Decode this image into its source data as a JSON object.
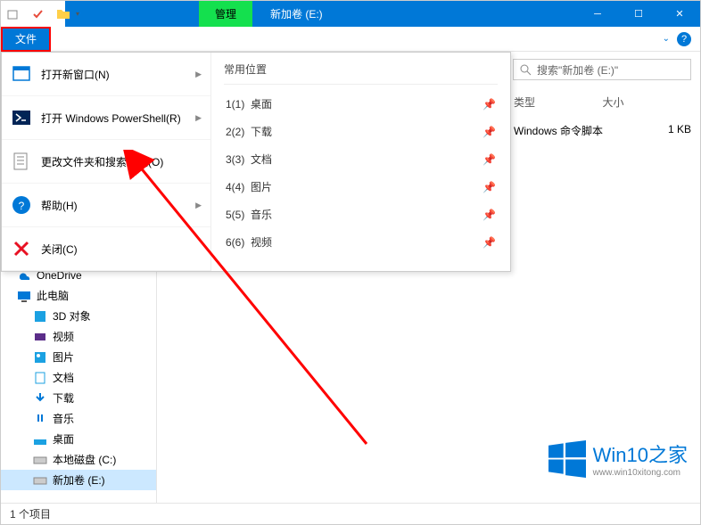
{
  "titlebar": {
    "manage": "管理",
    "title": "新加卷 (E:)"
  },
  "ribbon": {
    "file": "文件"
  },
  "search": {
    "placeholder": "搜索\"新加卷 (E:)\""
  },
  "columns": {
    "type": "类型",
    "size": "大小"
  },
  "file_row": {
    "name": "Windows 命令脚本",
    "size": "1 KB"
  },
  "filemenu": {
    "new_window": "打开新窗口(N)",
    "powershell": "打开 Windows PowerShell(R)",
    "options": "更改文件夹和搜索选项(O)",
    "help": "帮助(H)",
    "close": "关闭(C)",
    "locations_head": "常用位置",
    "loc": [
      {
        "k": "1(1)",
        "n": "桌面"
      },
      {
        "k": "2(2)",
        "n": "下载"
      },
      {
        "k": "3(3)",
        "n": "文档"
      },
      {
        "k": "4(4)",
        "n": "图片"
      },
      {
        "k": "5(5)",
        "n": "音乐"
      },
      {
        "k": "6(6)",
        "n": "视频"
      }
    ]
  },
  "nav": {
    "onedrive": "OneDrive",
    "thispc": "此电脑",
    "items": [
      "3D 对象",
      "视频",
      "图片",
      "文档",
      "下载",
      "音乐",
      "桌面",
      "本地磁盘 (C:)",
      "新加卷 (E:)"
    ]
  },
  "status": {
    "count": "1 个项目"
  },
  "watermark": {
    "main": "Win10之家",
    "sub": "www.win10xitong.com"
  }
}
